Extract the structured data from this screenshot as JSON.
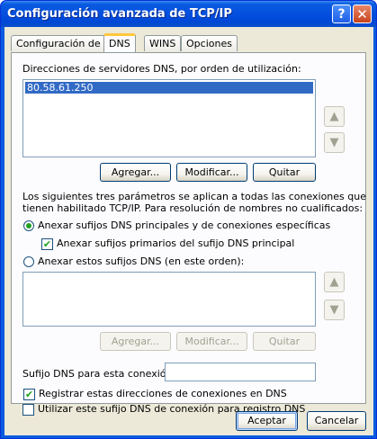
{
  "window": {
    "title": "Configuración avanzada de TCP/IP",
    "help_label": "?",
    "close_label": "✕"
  },
  "tabs": [
    {
      "label": "Configuración de IP"
    },
    {
      "label": "DNS"
    },
    {
      "label": "WINS"
    },
    {
      "label": "Opciones"
    }
  ],
  "dns": {
    "servers_label": "Direcciones de servidores DNS, por orden de utilización:",
    "servers": [
      "80.58.61.250"
    ],
    "add_label": "Agregar...",
    "edit_label": "Modificar...",
    "remove_label": "Quitar",
    "info_text_1": "Los siguientes tres parámetros se aplican a todas las conexiones que",
    "info_text_2": "tienen habilitado TCP/IP. Para resolución de nombres no cualificados:",
    "radio_primary_label": "Anexar sufijos DNS principales y de conexiones específicas",
    "radio_primary_selected": true,
    "check_parent_label": "Anexar sufijos primarios del sufijo DNS principal",
    "check_parent_checked": true,
    "radio_these_label": "Anexar estos sufijos DNS (en este orden):",
    "radio_these_selected": false,
    "suffix_add_label": "Agregar...",
    "suffix_edit_label": "Modificar...",
    "suffix_remove_label": "Quitar",
    "conn_suffix_label": "Sufijo DNS para esta conexión:",
    "conn_suffix_value": "",
    "register_label": "Registrar estas direcciones de conexiones en DNS",
    "register_checked": true,
    "use_suffix_label": "Utilizar este sufijo DNS de conexión para registro DNS",
    "use_suffix_checked": false
  },
  "footer": {
    "ok_label": "Aceptar",
    "cancel_label": "Cancelar"
  },
  "icons": {
    "up": "arrow-up-icon",
    "down": "arrow-down-icon"
  }
}
